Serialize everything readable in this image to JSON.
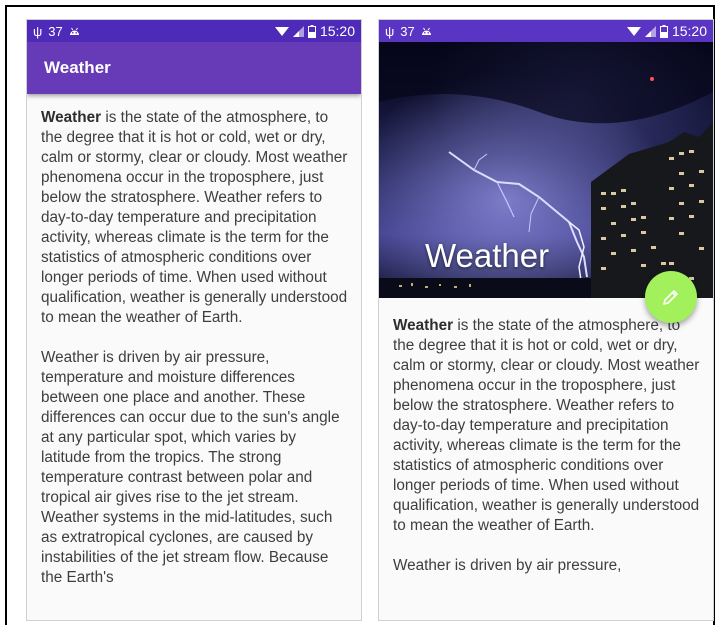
{
  "left_phone": {
    "status_bar": {
      "usb_glyph": "ψ",
      "battery_percent": "37",
      "time": "15:20"
    },
    "app_bar": {
      "title": "Weather"
    },
    "paragraphs": [
      {
        "lead_bold": "Weather",
        "text": " is the state of the atmosphere, to the degree that it is hot or cold, wet or dry, calm or stormy, clear or cloudy. Most weather phenomena occur in the troposphere, just below the stratosphere. Weather refers to day-to-day temperature and precipitation activity, whereas climate is the term for the statistics of atmospheric conditions over longer periods of time. When used without qualification, weather is generally understood to mean the weather of Earth."
      },
      {
        "lead_bold": "",
        "text": "Weather is driven by air pressure, temperature and moisture differences between one place and another. These differences can occur due to the sun's angle at any particular spot, which varies by latitude from the tropics. The strong temperature contrast between polar and tropical air gives rise to the jet stream. Weather systems in the mid-latitudes, such as extratropical cyclones, are caused by instabilities of the jet stream flow. Because the Earth's"
      }
    ]
  },
  "right_phone": {
    "status_bar": {
      "usb_glyph": "ψ",
      "battery_percent": "37",
      "time": "15:20"
    },
    "hero": {
      "title": "Weather"
    },
    "fab": {
      "icon": "pencil-icon",
      "color": "#a2f05b"
    },
    "paragraphs": [
      {
        "lead_bold": "Weather",
        "text": " is the state of the atmosphere, to the degree that it is hot or cold, wet or dry, calm or stormy, clear or cloudy. Most weather phenomena occur in the troposphere, just below the stratosphere. Weather refers to day-to-day temperature and precipitation activity, whereas climate is the term for the statistics of atmospheric conditions over longer periods of time. When used without qualification, weather is generally understood to mean the weather of Earth."
      },
      {
        "lead_bold": "",
        "text": "Weather is driven by air pressure,"
      }
    ]
  },
  "colors": {
    "app_bar": "#673ab7",
    "status_bar": "#4d2ab8",
    "fab": "#a2f05b",
    "body_text": "#3e3e3e"
  }
}
